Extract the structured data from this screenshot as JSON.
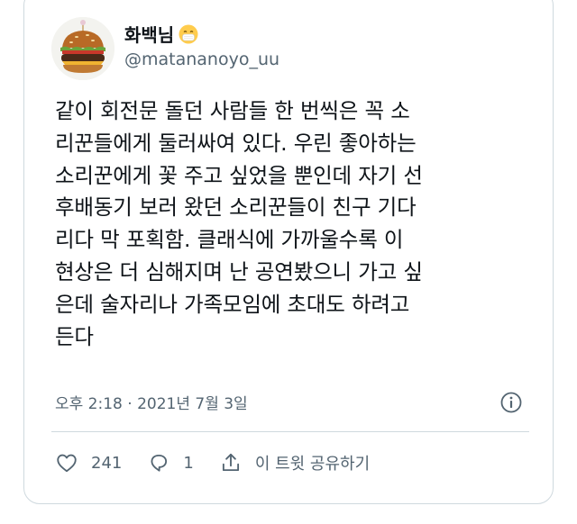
{
  "tweet": {
    "author": {
      "display_name": "화백님",
      "handle": "@matananoyo_uu",
      "name_emoji_icon": "face-with-medical-mask-icon",
      "avatar_icon": "hamburger-avatar"
    },
    "text": "같이 회전문 돌던 사람들 한 번씩은 꼭 소\n리꾼들에게 둘러싸여 있다. 우린 좋아하는\n소리꾼에게 꽃 주고 싶었을 뿐인데 자기 선\n후배동기 보러 왔던 소리꾼들이 친구 기다\n리다 막 포획함. 클래식에 가까울수록 이\n현상은 더 심해지며 난 공연봤으니 가고 싶\n은데 술자리나 가족모임에 초대도 하려고\n든다",
    "timestamp": "오후 2:18 · 2021년 7월 3일",
    "info_icon": "info-icon"
  },
  "actions": {
    "like_count": "241",
    "reply_count": "1",
    "share_label": "이 트윗 공유하기"
  },
  "colors": {
    "text_primary": "#0f1419",
    "text_secondary": "#536471",
    "border": "#cfd9de"
  }
}
